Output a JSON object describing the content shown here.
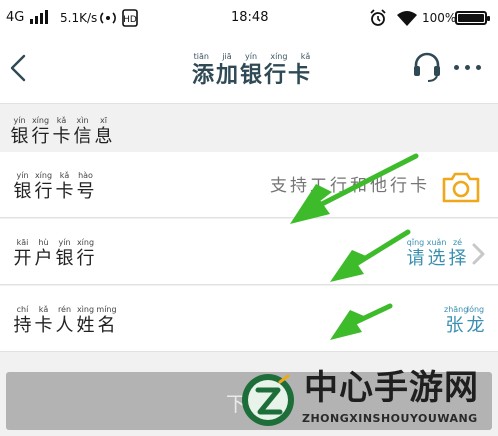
{
  "status_bar": {
    "network": "4G",
    "speed": "5.1K/s",
    "time": "18:48",
    "battery": "100%",
    "icons": [
      "signal-icon",
      "hotspot-icon",
      "volte-icon",
      "alarm-icon",
      "wifi-icon",
      "battery-icon"
    ]
  },
  "nav": {
    "title": "添加银行卡",
    "title_pinyin": [
      "tiān",
      "jiā",
      "yín",
      "xíng",
      "kǎ"
    ],
    "back_icon": "chevron-left-icon",
    "support_icon": "headset-icon",
    "more_icon": "more-icon"
  },
  "section": {
    "title_chars": [
      "银",
      "行",
      "卡",
      "信",
      "息"
    ],
    "title_pinyin": [
      "yín",
      "xíng",
      "kǎ",
      "xìn",
      "xī"
    ]
  },
  "rows": [
    {
      "label_chars": [
        "银",
        "行",
        "卡",
        "号"
      ],
      "label_pinyin": [
        "yín",
        "xíng",
        "kǎ",
        "hào"
      ],
      "placeholder": "支持工行和他行卡",
      "action_icon": "camera-icon"
    },
    {
      "label_chars": [
        "开",
        "户",
        "银",
        "行"
      ],
      "label_pinyin": [
        "kāi",
        "hù",
        "yín",
        "xíng"
      ],
      "value_chars": [
        "请",
        "选",
        "择"
      ],
      "value_pinyin": [
        "qǐng",
        "xuǎn",
        "zé"
      ],
      "action_icon": "chevron-right-icon"
    },
    {
      "label_chars": [
        "持",
        "卡",
        "人",
        "姓",
        "名"
      ],
      "label_pinyin": [
        "chí",
        "kǎ",
        "rén",
        "xìng",
        "míng"
      ],
      "value_chars": [
        "张",
        "龙"
      ],
      "value_pinyin": [
        "zhāng",
        "lóng"
      ]
    }
  ],
  "submit": {
    "label": "下"
  },
  "colors": {
    "accent_blue": "#3a8fb0",
    "camera_orange": "#f0a81a",
    "arrow_green": "#3dbb2a",
    "title_color": "#2f4a55"
  },
  "watermark": {
    "cn": "中心手游网",
    "en": "ZHONGXINSHOUYOUWANG"
  }
}
